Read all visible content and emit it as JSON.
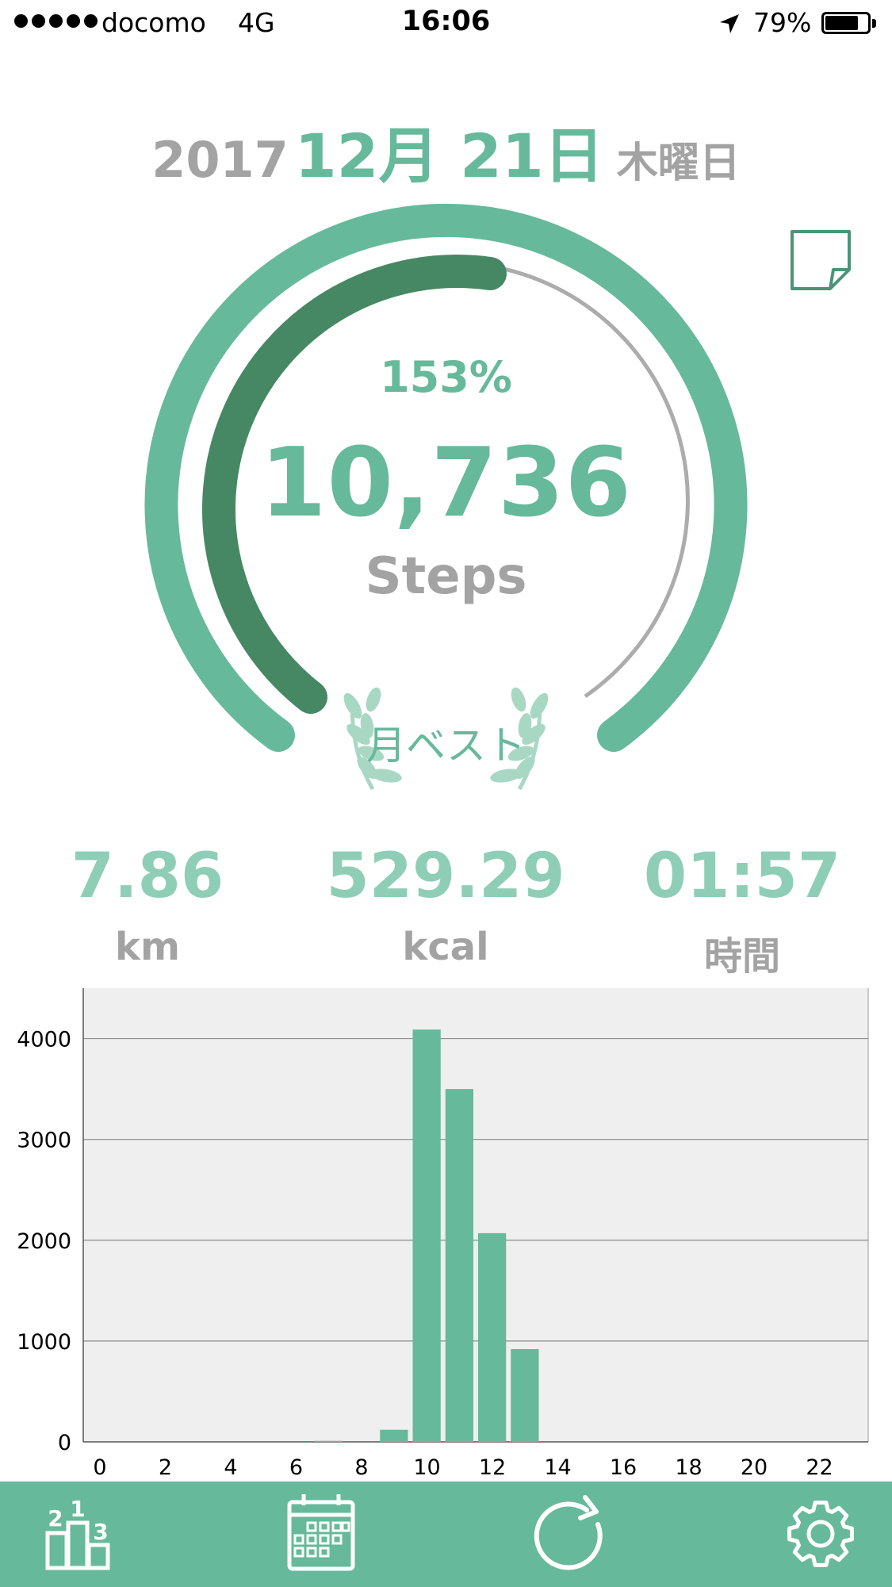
{
  "status_bar": {
    "carrier": "docomo",
    "network": "4G",
    "time": "16:06",
    "battery_percent": "79%",
    "battery_level": 0.79
  },
  "date": {
    "year": "2017",
    "month_day": "12月 21日",
    "weekday": "木曜日"
  },
  "summary": {
    "goal_percent": "153%",
    "goal_fraction": 1.53,
    "steps": "10,736",
    "steps_label": "Steps",
    "badge_label": "月ベスト"
  },
  "stats": {
    "distance": {
      "value": "7.86",
      "unit": "km"
    },
    "calories": {
      "value": "529.29",
      "unit": "kcal"
    },
    "duration": {
      "value": "01:57",
      "unit": "時間"
    }
  },
  "colors": {
    "accent": "#67b99b",
    "accent_dark": "#468863",
    "accent_light": "#8fceb6",
    "gray_text": "#a3a3a3",
    "chart_bg": "#efefef"
  },
  "icons": {
    "memo": "note-icon",
    "tabs": [
      "ranking-icon",
      "calendar-icon",
      "refresh-icon",
      "gear-icon"
    ]
  },
  "chart_data": {
    "type": "bar",
    "x": [
      0,
      1,
      2,
      3,
      4,
      5,
      6,
      7,
      8,
      9,
      10,
      11,
      12,
      13,
      14,
      15,
      16,
      17,
      18,
      19,
      20,
      21,
      22,
      23
    ],
    "values": [
      0,
      0,
      0,
      0,
      0,
      0,
      0,
      10,
      0,
      120,
      4090,
      3500,
      2070,
      920,
      0,
      0,
      0,
      0,
      0,
      0,
      0,
      0,
      0,
      0
    ],
    "x_tick_labels": [
      "0",
      "2",
      "4",
      "6",
      "8",
      "10",
      "12",
      "14",
      "16",
      "18",
      "20",
      "22"
    ],
    "y_tick_labels": [
      "0",
      "1000",
      "2000",
      "3000",
      "4000"
    ],
    "ylim": [
      0,
      4500
    ],
    "xlabel": "",
    "ylabel": "",
    "grid": true,
    "color": "#67b99b"
  }
}
